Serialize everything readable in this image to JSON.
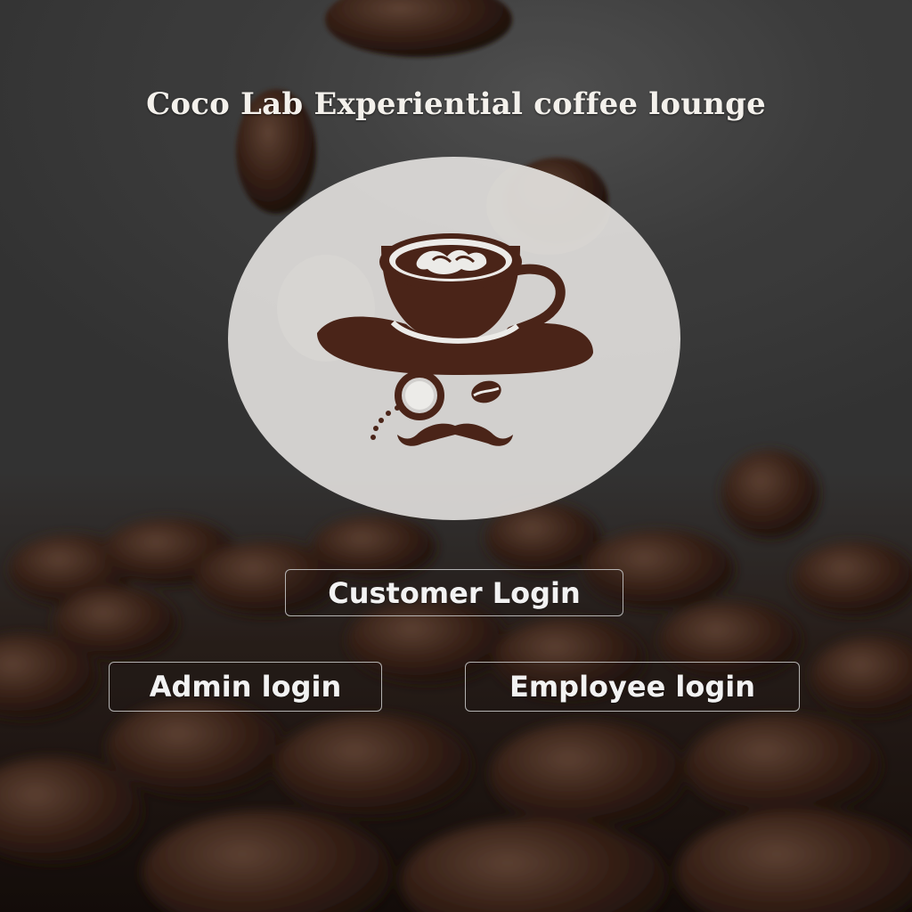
{
  "header": {
    "title": "Coco Lab Experiential coffee lounge"
  },
  "logo": {
    "icon": "coffee-gentleman-logo",
    "colors": {
      "brown": "#4a2418",
      "circle_fill": "#ecebe8"
    }
  },
  "buttons": {
    "customer_login": "Customer Login",
    "admin_login": "Admin login",
    "employee_login": "Employee login"
  },
  "theme": {
    "background": "coffee-beans-photo",
    "text_color": "#f2f2f2"
  }
}
